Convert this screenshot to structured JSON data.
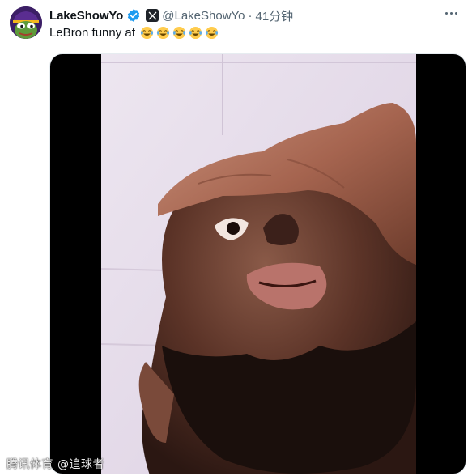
{
  "tweet": {
    "display_name": "LakeShowYo",
    "handle": "@LakeShowYo",
    "separator": "·",
    "time": "41分钟",
    "text": "LeBron funny af",
    "emojis": [
      "😂",
      "😂",
      "😂",
      "😂",
      "😂"
    ]
  },
  "icons": {
    "avatar": "pepe-frog-lakers-avatar",
    "verified": "verified-badge-icon",
    "platform": "x-logo-icon",
    "more": "more-options-icon",
    "emoji": "tears-of-joy-emoji"
  },
  "colors": {
    "text_primary": "#0f1419",
    "text_secondary": "#536471",
    "verified_blue": "#1d9bf0",
    "media_background": "#000000"
  },
  "watermark": {
    "text": "腾讯体育 @追球者"
  }
}
